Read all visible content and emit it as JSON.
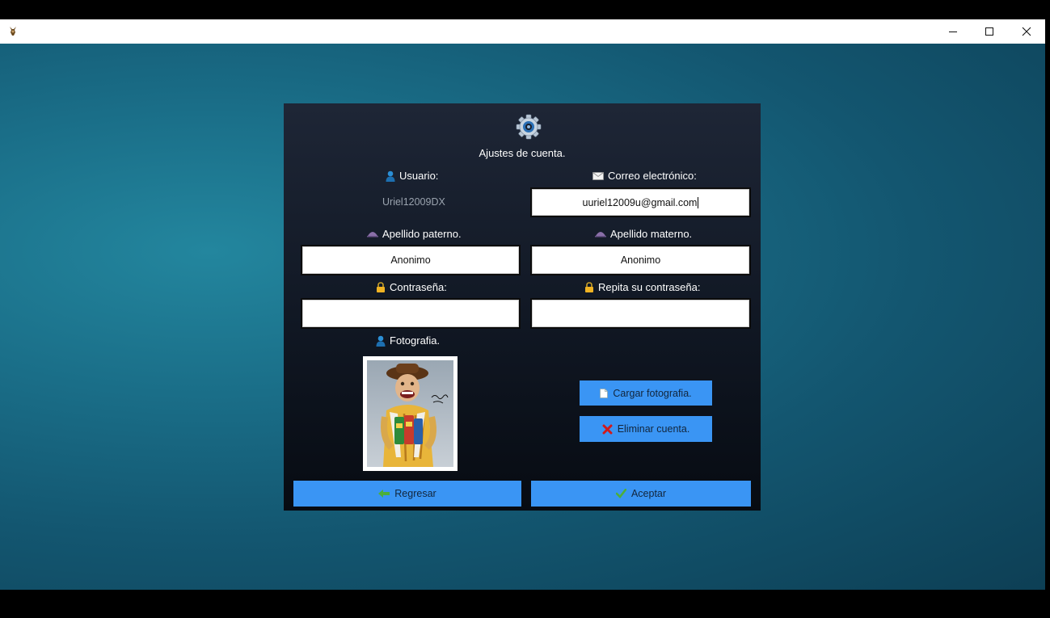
{
  "window": {
    "minimize_glyph": "─",
    "close_glyph": "✕"
  },
  "header": {
    "title": "Ajustes de cuenta.",
    "icon": "gear-icon"
  },
  "fields": {
    "usuario": {
      "label": "Usuario:",
      "value": "Uriel12009DX"
    },
    "correo": {
      "label": "Correo electrónico:",
      "value": "uuriel12009u@gmail.com"
    },
    "apellido_paterno": {
      "label": "Apellido paterno.",
      "value": "Anonimo"
    },
    "apellido_materno": {
      "label": "Apellido materno.",
      "value": "Anonimo"
    },
    "contrasena": {
      "label": "Contraseña:",
      "value": ""
    },
    "repita_contrasena": {
      "label": "Repita su contraseña:",
      "value": ""
    },
    "fotografia": {
      "label": "Fotografia."
    }
  },
  "buttons": {
    "cargar": "Cargar fotografia.",
    "eliminar": "Eliminar cuenta.",
    "regresar": "Regresar",
    "aceptar": "Aceptar"
  },
  "colors": {
    "button_blue": "#3a95f4",
    "panel_top": "#1e2636",
    "panel_bottom": "#070b12",
    "desktop_teal": "#1a6e88"
  }
}
